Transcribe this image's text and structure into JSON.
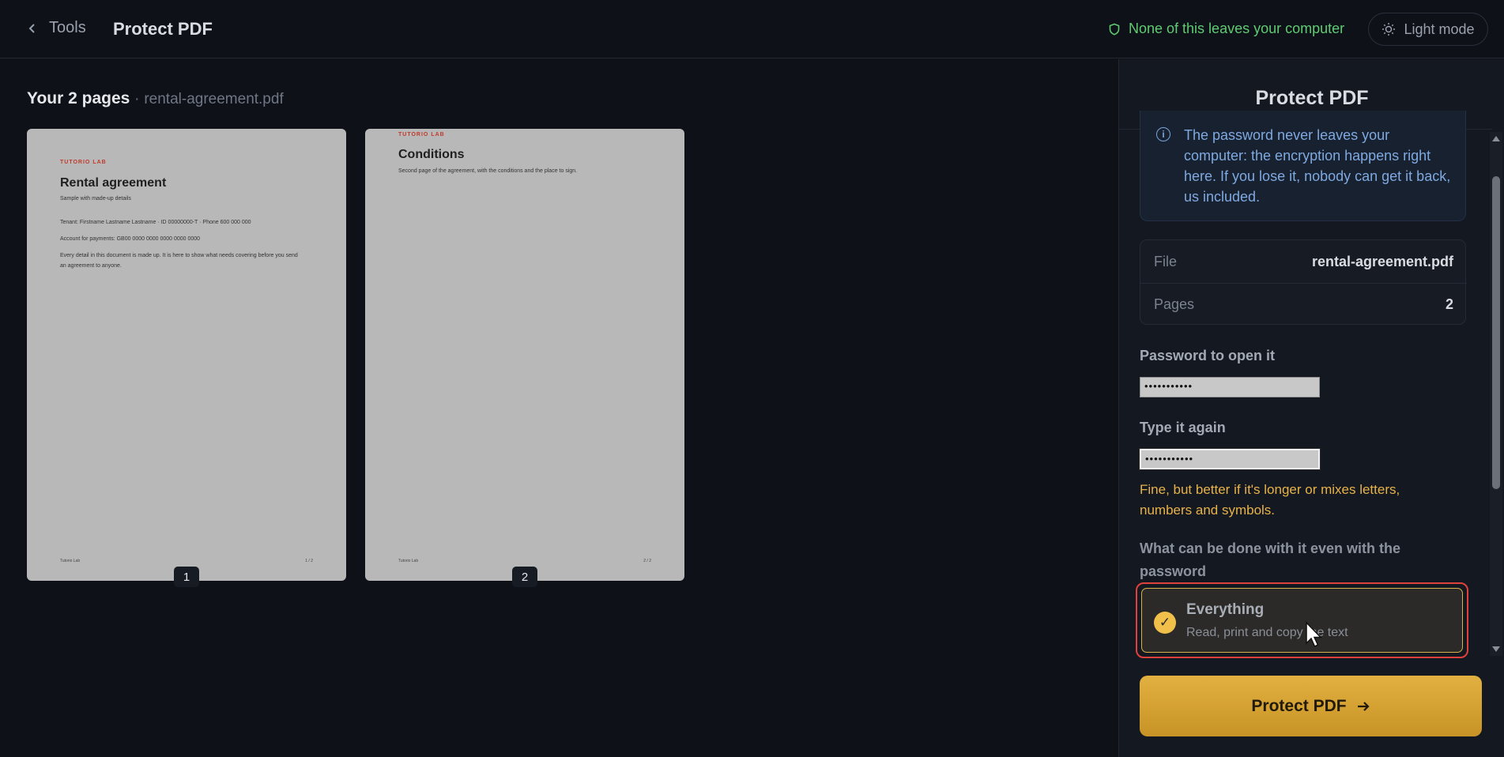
{
  "topbar": {
    "back_label": "Tools",
    "title": "Protect PDF",
    "privacy_text": "None of this leaves your computer",
    "theme_toggle_label": "Light mode"
  },
  "preview": {
    "count_label": "Your 2 pages",
    "separator": "·",
    "filename": "rental-agreement.pdf",
    "pages": [
      {
        "number": "1",
        "brand": "TUTORIO LAB",
        "title": "Rental agreement",
        "subtitle": "Sample with made-up details",
        "lines": [
          "Tenant: Firstname Lastname Lastname · ID 00000000-T · Phone 600 000 000",
          "Account for payments: GB00 0000 0000 0000 0000 0000",
          "Every detail in this document is made up. It is here to show what needs covering before you send",
          "an agreement to anyone."
        ],
        "footer_left": "Tutorio Lab",
        "footer_right": "1 / 2"
      },
      {
        "number": "2",
        "brand": "TUTORIO LAB",
        "title": "Conditions",
        "subtitle": "Second page of the agreement, with the conditions and the place to sign.",
        "footer_left": "Tutorio Lab",
        "footer_right": "2 / 2"
      }
    ]
  },
  "panel": {
    "title": "Protect PDF",
    "info_text": "The password never leaves your computer: the encryption happens right here. If you lose it, nobody can get it back, us included.",
    "meta": {
      "file_label": "File",
      "file_value": "rental-agreement.pdf",
      "pages_label": "Pages",
      "pages_value": "2"
    },
    "password_label": "Password to open it",
    "password_value": "•••••••••••",
    "confirm_label": "Type it again",
    "confirm_value": "•••••••••••",
    "strength_hint": "Fine, but better if it's longer or mixes letters, numbers and symbols.",
    "permissions_label": "What can be done with it even with the password",
    "option": {
      "title": "Everything",
      "subtitle": "Read, print and copy the text",
      "check": "✓"
    },
    "cta_label": "Protect PDF"
  },
  "colors": {
    "background": "#0e1118",
    "panel": "#141820",
    "accent": "#e2b040",
    "privacy_green": "#5fcb72",
    "warning": "#e8b24a",
    "info_blue": "#7fa9e0",
    "highlight_red": "#e0413b"
  },
  "icons": [
    "chevron-left-icon",
    "shield-icon",
    "sun-icon",
    "info-icon",
    "check-icon",
    "arrow-right-icon",
    "mouse-cursor-icon"
  ]
}
